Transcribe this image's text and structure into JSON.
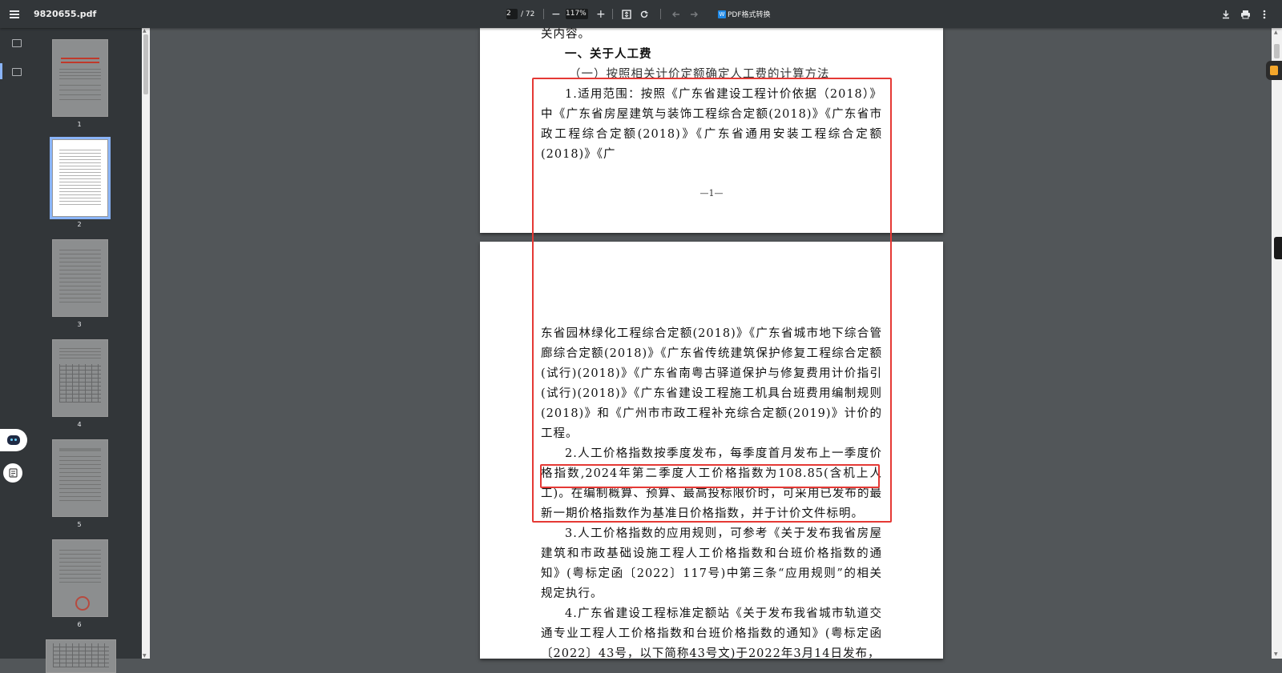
{
  "toolbar": {
    "filename": "9820655.pdf",
    "current_page": "2",
    "total_pages": "/ 72",
    "zoom_minus": "−",
    "zoom": "117%",
    "zoom_plus": "+",
    "convert_label": "PDF格式转换"
  },
  "thumbnails": {
    "items": [
      {
        "label": "1"
      },
      {
        "label": "2"
      },
      {
        "label": "3"
      },
      {
        "label": "4"
      },
      {
        "label": "5"
      },
      {
        "label": "6"
      }
    ],
    "active_index": 1
  },
  "page_a": {
    "lead": "关内容。",
    "heading": "一、关于人工费",
    "subheading": "（一）按照相关计价定额确定人工费的计算方法",
    "para1": "1.适用范围：按照《广东省建设工程计价依据（2018）》中《广东省房屋建筑与装饰工程综合定额(2018)》《广东省市政工程综合定额(2018)》《广东省通用安装工程综合定额(2018)》《广",
    "footer": "—1—"
  },
  "page_b": {
    "para1_cont": "东省园林绿化工程综合定额(2018)》《广东省城市地下综合管廊综合定额(2018)》《广东省传统建筑保护修复工程综合定额(试行)(2018)》《广东省南粤古驿道保护与修复费用计价指引(试行)(2018)》《广东省建设工程施工机具台班费用编制规则(2018)》和《广州市市政工程补充综合定额(2019)》计价的工程。",
    "para2": "2.人工价格指数按季度发布，每季度首月发布上一季度价格指数,2024年第二季度人工价格指数为108.85(含机上人工)。在编制概算、预算、最高投标限价时，可采用已发布的最新一期价格指数作为基准日价格指数，并于计价文件标明。",
    "para3": "3.人工价格指数的应用规则，可参考《关于发布我省房屋建筑和市政基础设施工程人工价格指数和台班价格指数的通知》(粤标定函〔2022〕117号)中第三条“应用规则”的相关规定执行。",
    "para4": "4.广东省建设工程标准定额站《关于发布我省城市轨道交通专业工程人工价格指数和台班价格指数的通知》(粤标定函〔2022〕43号，以下简称43号文)于2022年3月14日发布，"
  },
  "colors": {
    "toolbar_bg": "#323639",
    "viewer_bg": "#525659",
    "annotation_red": "#e53935",
    "thumb_active": "#8ab4f8"
  },
  "icons": [
    "menu-icon",
    "fit-page-icon",
    "rotate-icon",
    "back-icon",
    "forward-icon",
    "download-icon",
    "print-icon",
    "more-icon",
    "thumbnail-view-icon",
    "outline-view-icon"
  ]
}
